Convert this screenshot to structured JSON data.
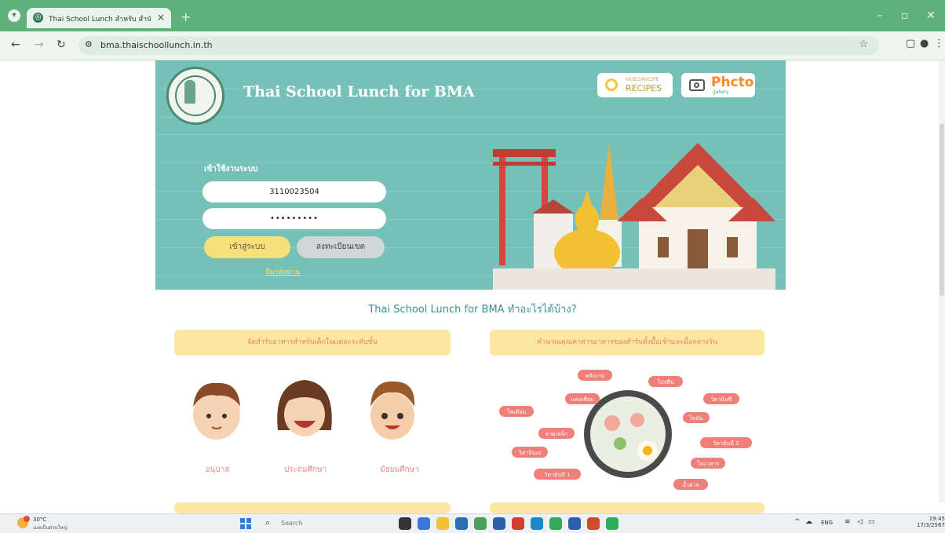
{
  "browser": {
    "tab_title": "Thai School Lunch สำหรับ สำนัก",
    "url": "bma.thaischoollunch.in.th",
    "new_tab": "+",
    "close_tab": "×"
  },
  "header": {
    "site_title": "Thai School Lunch for BMA",
    "recipes_badge": {
      "small": "VIDEO/RECIPE",
      "label": "RECIPES"
    },
    "photo_badge": {
      "label": "Phcto",
      "small": "gallery"
    }
  },
  "login": {
    "title": "เข้าใช้งานระบบ",
    "username_value": "3110023504",
    "password_value": "•••••••••",
    "login_button": "เข้าสู่ระบบ",
    "register_button": "ลงทะเบียนเขต",
    "forgot_link": "ลืมรหัสผ่าน"
  },
  "tagline": "Thai School Lunch for BMA   ทำอะไรได้บ้าง?",
  "features": {
    "left_title": "จัดสำรับอาหารสำหรับเด็กในแต่ละระดับชั้น",
    "right_title": "คำนวณคุณค่าสารอาหารของสำรับทั้งมื้อเช้าและมื้อกลางวัน",
    "levels": [
      "อนุบาล",
      "ประถมศึกษา",
      "มัธยมศึกษา"
    ],
    "nutrients": [
      "พลังงาน",
      "โปรตีน",
      "แคลเซียม",
      "วิตามินซี",
      "ไขมัน",
      "โซเดียม",
      "ธาตุเหล็ก",
      "วิตามินบี 2",
      "วิตามินเอ",
      "ใยอาหาร",
      "วิตามินบี 1",
      "น้ำตาล"
    ]
  },
  "taskbar": {
    "temperature": "30°C",
    "condition": "เมฆเป็นส่วนใหญ่",
    "search_placeholder": "Search",
    "language": "ENG",
    "time": "19:45",
    "date": "17/3/2567"
  },
  "colors": {
    "hero_bg": "#75c1b8",
    "tab_bar": "#5fb07a",
    "accent_yellow": "#f7e07a",
    "tagline": "#3a8f93",
    "card_bg": "#fce7a0",
    "nutrient_tag": "#f07f79"
  }
}
